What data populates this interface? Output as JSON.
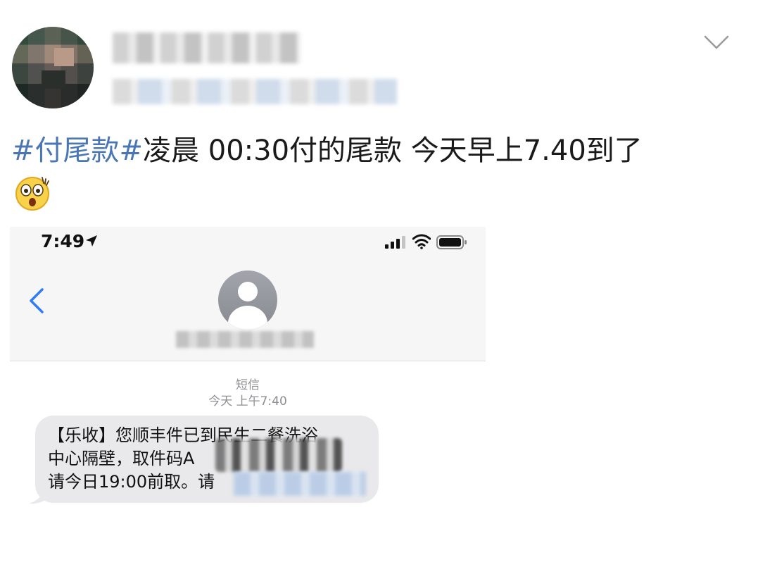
{
  "post": {
    "hashtag": "#付尾款#",
    "text": "凌晨 00:30付的尾款 今天早上7.40到了",
    "emoji_icon": "astonished-face-emoji",
    "colors": {
      "hashtag": "#4a77b3",
      "text": "#1a1a1a"
    }
  },
  "screenshot": {
    "status_bar": {
      "time": "7:49",
      "icons": [
        "location-arrow-icon",
        "cellular-signal-icon",
        "wifi-icon",
        "battery-icon"
      ]
    },
    "conversation": {
      "label": "短信",
      "timestamp": "今天 上午7:40",
      "message_lines": [
        "【乐收】您顺丰件已到民生二餐洗浴",
        "中心隔壁，取件码A",
        "请今日19:00前取。请"
      ]
    },
    "colors": {
      "back_chevron": "#2f7cf6",
      "bubble": "#e9e9eb",
      "meta_text": "#8e8e93"
    }
  }
}
